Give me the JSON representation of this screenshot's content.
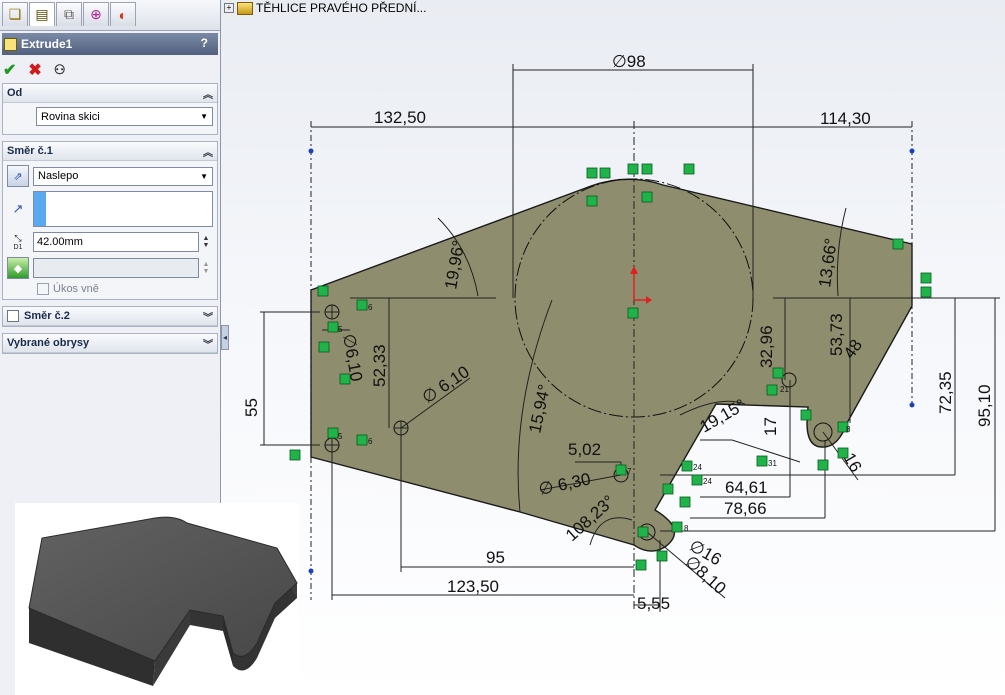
{
  "property_manager": {
    "feature_title": "Extrude1",
    "help_glyph": "?",
    "tabs": [
      "feature-manager-icon",
      "property-manager-icon",
      "configuration-manager-icon",
      "dimxpert-icon",
      "display-manager-icon"
    ],
    "from": {
      "header": "Od",
      "value": "Rovina skici"
    },
    "direction1": {
      "header": "Směr č.1",
      "end_condition": "Naslepo",
      "depth": "42.00mm",
      "depth_tag": "D1",
      "draft_label": "Úkos vně"
    },
    "direction2": {
      "header": "Směr č.2"
    },
    "selected_contours": {
      "header": "Vybrané obrysy"
    }
  },
  "tree": {
    "item_label": "TĚHLICE PRAVÉHO PŘEDNÍ..."
  },
  "sketch": {
    "dimensions": {
      "d98": "∅98",
      "d132": "132,50",
      "d114": "114,30",
      "a1996": "19,96°",
      "a1366": "13,66°",
      "d55": "55",
      "d5233": "52,33",
      "d610a": "∅ 6,10",
      "d610b": "∅6,10",
      "a1594": "15,94°",
      "d3296": "32,96",
      "d5373": "53,73",
      "d48": "48",
      "a1915": "19,15°",
      "d17": "17",
      "d7235": "72,35",
      "d9510": "95,10",
      "d502": "5,02",
      "d630": "∅ 6,30",
      "d6461": "64,61",
      "d7866": "78,66",
      "a10823": "108,23°",
      "d16": "∅16",
      "d810": "∅8,10",
      "r16": "16",
      "d95": "95",
      "d12350": "123,50",
      "d555": "5,55"
    },
    "relation_numbers": [
      "5",
      "5",
      "6",
      "6",
      "7",
      "21",
      "24",
      "24",
      "31",
      "8",
      "8"
    ],
    "colors": {
      "face": "#8e8d6d",
      "relation_green": "#1fb34a",
      "origin_red": "#e02020"
    }
  }
}
